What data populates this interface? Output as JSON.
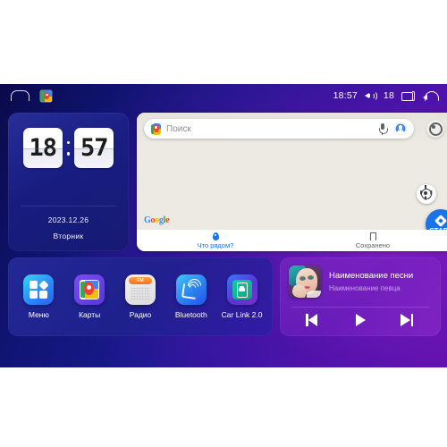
{
  "statusbar": {
    "home_icon": "home-icon",
    "maps_icon": "google-maps-icon",
    "time": "18:57",
    "volume_icon": "volume-icon",
    "volume_level": "18",
    "recents_icon": "recents-icon",
    "back_icon": "back-icon"
  },
  "clock_widget": {
    "hours": "18",
    "minutes": "57",
    "date": "2023.12.26",
    "weekday": "Вторник"
  },
  "maps_widget": {
    "search": {
      "placeholder": "Поиск",
      "pin_icon": "google-maps-pin-icon",
      "mic_icon": "microphone-icon",
      "avatar_icon": "account-avatar-icon"
    },
    "settings_icon": "settings-gear-icon",
    "watermark": {
      "g1": "G",
      "o1": "o",
      "o2": "o",
      "g2": "g",
      "l": "l",
      "e": "e"
    },
    "locate_icon": "locate-me-icon",
    "start_button": {
      "label": "СТАРТ",
      "icon": "navigation-arrow-icon"
    },
    "bottom_bar": [
      {
        "label": "Что рядом?",
        "icon": "place-pin-icon",
        "active": true
      },
      {
        "label": "Сохранено",
        "icon": "bookmark-icon",
        "active": false
      }
    ]
  },
  "dock": {
    "apps": [
      {
        "label": "Меню",
        "icon": "apps-grid-icon"
      },
      {
        "label": "Карты",
        "icon": "google-maps-icon"
      },
      {
        "label": "Радио",
        "icon": "fm-radio-icon",
        "display": "FM"
      },
      {
        "label": "Bluetooth",
        "icon": "bluetooth-phone-icon"
      },
      {
        "label": "Car Link 2.0",
        "icon": "car-link-icon"
      }
    ]
  },
  "music_widget": {
    "album_art": "album-art-portrait",
    "title": "Наименование песни",
    "artist": "Наименование певца",
    "controls": [
      {
        "name": "previous",
        "icon": "skip-previous-icon"
      },
      {
        "name": "play",
        "icon": "play-icon"
      },
      {
        "name": "next",
        "icon": "skip-next-icon"
      }
    ]
  },
  "colors": {
    "accent_blue": "#1a73e8",
    "bg_blue": "#171a8e",
    "bg_purple": "#6a10b8",
    "map_bg": "#ebe8e1"
  }
}
